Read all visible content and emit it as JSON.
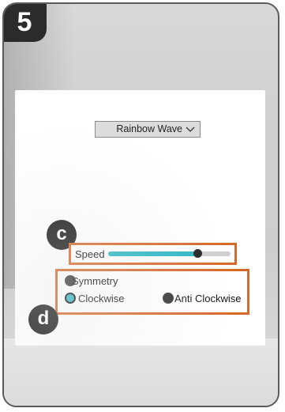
{
  "step_label": "5",
  "effect_dropdown": {
    "selected": "Rainbow Wave",
    "icon": "chevron-down-icon"
  },
  "badges": {
    "speed": "c",
    "direction": "d"
  },
  "speed": {
    "label": "Speed",
    "value_fraction": 0.73
  },
  "options": {
    "symmetry": {
      "label": "Symmetry",
      "selected": false
    },
    "clockwise": {
      "label": "Clockwise",
      "selected": true
    },
    "anti_clockwise": {
      "label": "Anti Clockwise",
      "selected": false
    }
  },
  "colors": {
    "highlight": "#d6692a",
    "accent": "#2bb7c4",
    "badge": "#1b1b1b"
  }
}
